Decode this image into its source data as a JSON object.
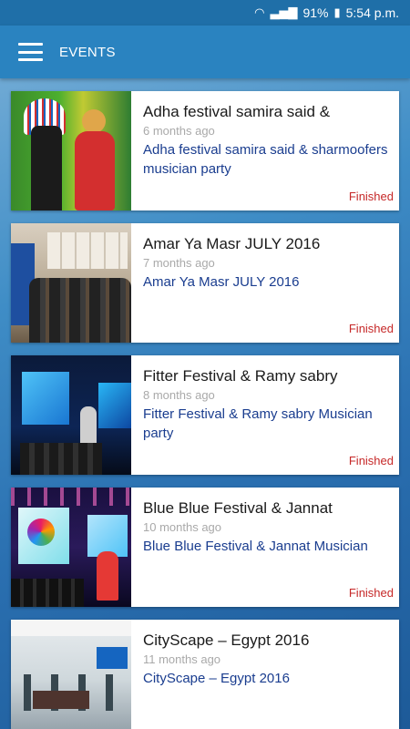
{
  "status_bar": {
    "signal_icons": "wifi-icon signal-icon",
    "battery": "91%",
    "time": "5:54 p.m."
  },
  "app_bar": {
    "title": "EVENTS"
  },
  "colors": {
    "status_bar": "#1f6fa8",
    "app_bar": "#2a83c0",
    "status_finished": "#c62828",
    "description": "#1a3d8f"
  },
  "events": [
    {
      "title": "Adha festival samira said &",
      "time_ago": "6 months ago",
      "description": "Adha festival samira said & sharmoofers musician party",
      "status": "Finished"
    },
    {
      "title": "Amar Ya Masr JULY 2016",
      "time_ago": "7 months ago",
      "description": "Amar Ya Masr JULY 2016",
      "status": "Finished"
    },
    {
      "title": "Fitter Festival & Ramy sabry",
      "time_ago": "8 months ago",
      "description": "Fitter Festival & Ramy sabry Musician party",
      "status": "Finished"
    },
    {
      "title": "Blue Blue Festival & Jannat",
      "time_ago": "10 months ago",
      "description": "Blue Blue Festival & Jannat Musician",
      "status": "Finished"
    },
    {
      "title": "CityScape – Egypt 2016",
      "time_ago": "11 months ago",
      "description": "CityScape – Egypt 2016",
      "status": ""
    }
  ]
}
